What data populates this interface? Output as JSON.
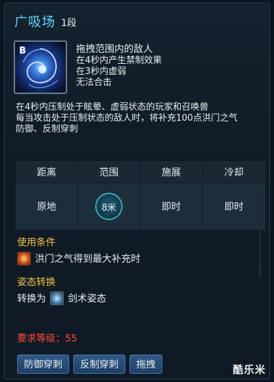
{
  "header": {
    "skill_name": "广吸场",
    "rank": "1段"
  },
  "icon": {
    "key_label": "B"
  },
  "effects": {
    "main": "拖拽范围内的敌人",
    "lines": [
      "在4秒内产生禁制效果",
      "在3秒内虚弱",
      "无法合击"
    ]
  },
  "description": {
    "line1": "在4秒内压制处于眩晕、虚弱状态的玩家和召唤兽",
    "line2": "每当攻击处于压制状态的敌人时，将补充100点洪门之气",
    "line3": "防御、反制穿刺"
  },
  "stats": {
    "headers": [
      "距离",
      "范围",
      "施展",
      "冷却"
    ],
    "values": [
      "原地",
      "8米",
      "即时",
      "即时"
    ]
  },
  "usage": {
    "title": "使用条件",
    "condition": "洪门之气得到最大补充时"
  },
  "stance": {
    "title": "姿态转换",
    "prefix": "转换为",
    "target": "剑术姿态"
  },
  "requirement": "要求等级：55",
  "tags": [
    "防御穿刺",
    "反制穿刺",
    "拖拽"
  ],
  "watermark": "酷乐米",
  "colors": {
    "title": "#5fd7ff",
    "section": "#f4c242",
    "requirement": "#ff4a3c",
    "tag": "#2f5a86"
  }
}
